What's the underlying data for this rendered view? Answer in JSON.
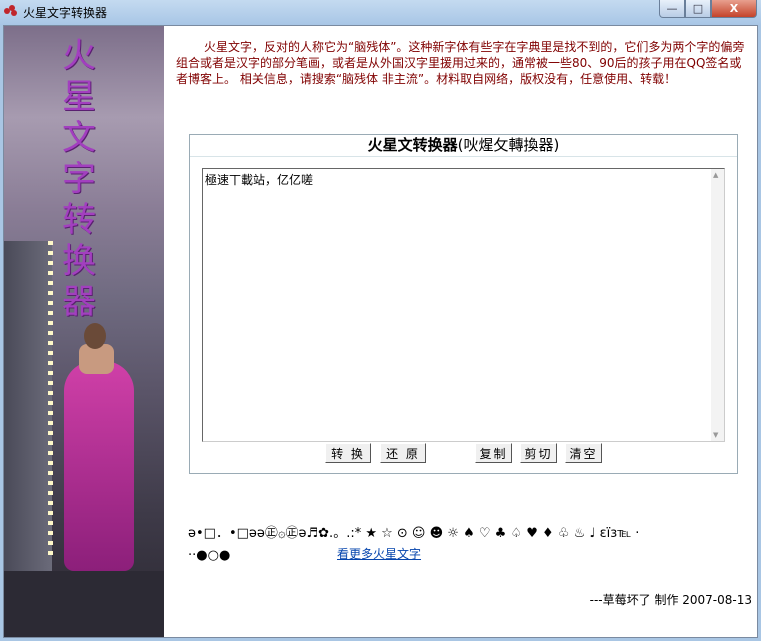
{
  "window": {
    "title": "火星文字转换器",
    "controls": {
      "minimize": "—",
      "maximize": "□",
      "close": "X"
    }
  },
  "side": {
    "vertical_title": "火星文字转换器"
  },
  "intro": "火星文字，反对的人称它为“脑残体”。这种新字体有些字在字典里是找不到的，它们多为两个字的偏旁组合或者是汉字的部分笔画，或者是从外国汉字里援用过来的，通常被一些80、90后的孩子用在QQ签名或者博客上。 相关信息，请搜索“脑残体 非主流”。材料取自网络，版权没有，任意使用、转载！",
  "converter": {
    "title_main": "火星文转换器",
    "title_sub": "(吙煋攵轉換器)",
    "text_value": "極速丅載站，亿亿嗟",
    "buttons": {
      "convert": "转 换",
      "restore": "还 原",
      "copy": "复制",
      "cut": "剪切",
      "clear": "清空"
    }
  },
  "symbols_line1": "ǝ•□．•□ǝǝ㊣۞㊣ǝ♬✿.。.:* ★ ☆ ⊙ ☺ ☻ ☼ ♠ ♡ ♣ ♤ ♥ ♦ ♧ ♨ ♩ εïз℡ ·",
  "symbols_line2": "··●○●",
  "more_link": "看更多火星文字",
  "credit": "---草莓坏了 制作 2007-08-13"
}
